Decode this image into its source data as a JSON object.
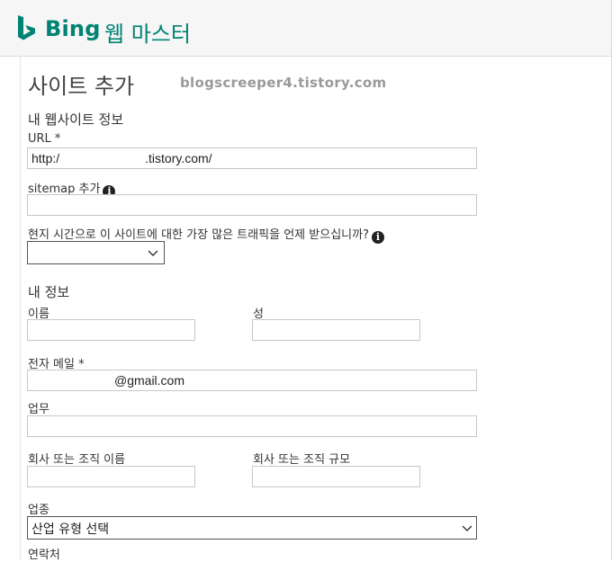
{
  "header": {
    "logo_text": "Bing",
    "product_name": "웹 마스터",
    "brand_color": "#008373"
  },
  "page": {
    "title": "사이트 추가",
    "watermark": "blogscreeper4.tistory.com"
  },
  "site_info": {
    "section_label": "내 웹사이트 정보",
    "url_label": "URL *",
    "url_value_prefix": "http:/",
    "url_value_suffix": ".tistory.com/",
    "sitemap_label": "sitemap 추가",
    "sitemap_value": "",
    "traffic_label": "현지 시간으로 이 사이트에 대한 가장 많은 트래픽을 언제 받으십니까?",
    "traffic_selected": "",
    "info_icon_name": "info-icon"
  },
  "my_info": {
    "section_label": "내 정보",
    "first_name_label": "이름",
    "first_name_value": "",
    "last_name_label": "성",
    "last_name_value": "",
    "email_label": "전자 메일 *",
    "email_value": "@gmail.com",
    "job_label": "업무",
    "job_value": "",
    "company_name_label": "회사 또는 조직 이름",
    "company_name_value": "",
    "company_size_label": "회사 또는 조직 규모",
    "company_size_value": "",
    "industry_label": "업종",
    "industry_selected": "산업 유형 선택",
    "contact_label": "연락처"
  }
}
